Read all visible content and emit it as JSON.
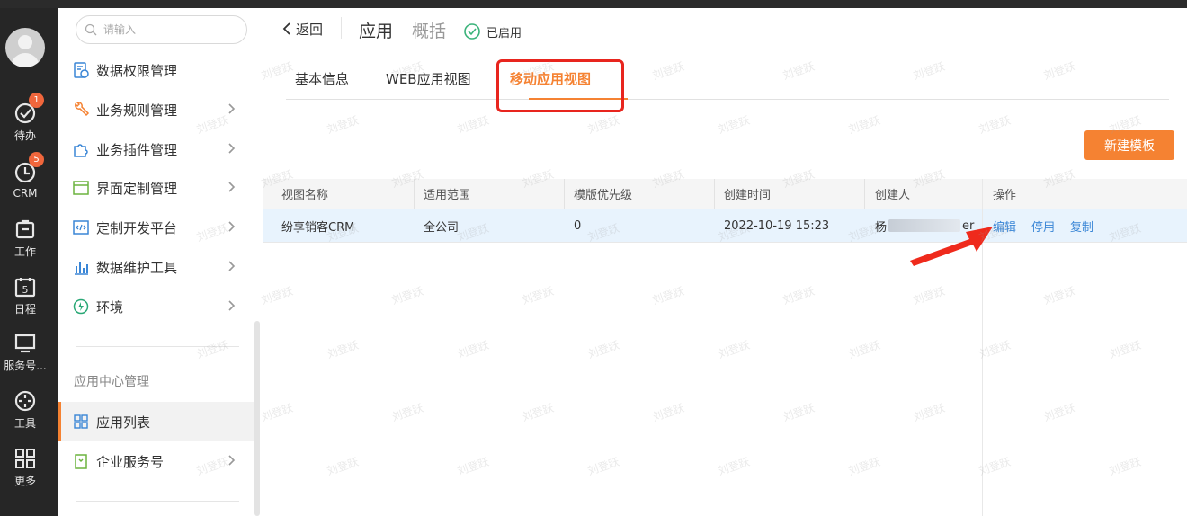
{
  "rail": {
    "items": [
      {
        "icon": "check-circle-icon",
        "label": "待办",
        "badge": "1"
      },
      {
        "icon": "crm-clock-icon",
        "label": "CRM",
        "badge": "5"
      },
      {
        "icon": "briefcase-icon",
        "label": "工作"
      },
      {
        "icon": "calendar-icon",
        "label": "日程",
        "calendar_day": "5"
      },
      {
        "icon": "monitor-icon",
        "label": "服务号..."
      },
      {
        "icon": "crosshair-icon",
        "label": "工具"
      },
      {
        "icon": "grid-icon",
        "label": "更多"
      }
    ]
  },
  "nav": {
    "search_placeholder": "请输入",
    "items": [
      {
        "label": "数据权限管理",
        "icon": "data-permission-icon"
      },
      {
        "label": "业务规则管理",
        "icon": "wrench-icon"
      },
      {
        "label": "业务插件管理",
        "icon": "puzzle-icon"
      },
      {
        "label": "界面定制管理",
        "icon": "window-icon"
      },
      {
        "label": "定制开发平台",
        "icon": "code-icon"
      },
      {
        "label": "数据维护工具",
        "icon": "bar-chart-icon"
      },
      {
        "label": "环境",
        "icon": "environment-icon"
      }
    ],
    "section_title": "应用中心管理",
    "section_items": [
      {
        "label": "应用列表",
        "icon": "app-list-icon",
        "active": true
      },
      {
        "label": "企业服务号",
        "icon": "service-account-icon"
      }
    ]
  },
  "header": {
    "back_label": "返回",
    "title": "应用",
    "subtitle": "概括",
    "status": "已启用"
  },
  "tabs": [
    {
      "label": "基本信息"
    },
    {
      "label": "WEB应用视图"
    },
    {
      "label": "移动应用视图",
      "active": true
    }
  ],
  "new_template_button": "新建模板",
  "table": {
    "headers": [
      "视图名称",
      "适用范围",
      "模版优先级",
      "创建时间",
      "创建人",
      "操作"
    ],
    "rows": [
      {
        "name": "纷享销客CRM",
        "scope": "全公司",
        "priority": "0",
        "created_at": "2022-10-19 15:23",
        "creator_prefix": "杨",
        "creator_suffix": "er",
        "actions": [
          "编辑",
          "停用",
          "复制"
        ]
      }
    ]
  },
  "watermark": "刘登跃",
  "colors": {
    "accent": "#f58232",
    "rail_bg": "#262626",
    "link": "#3a86d6",
    "highlight_box": "#e8251e",
    "selected_row": "#e8f3fd"
  }
}
